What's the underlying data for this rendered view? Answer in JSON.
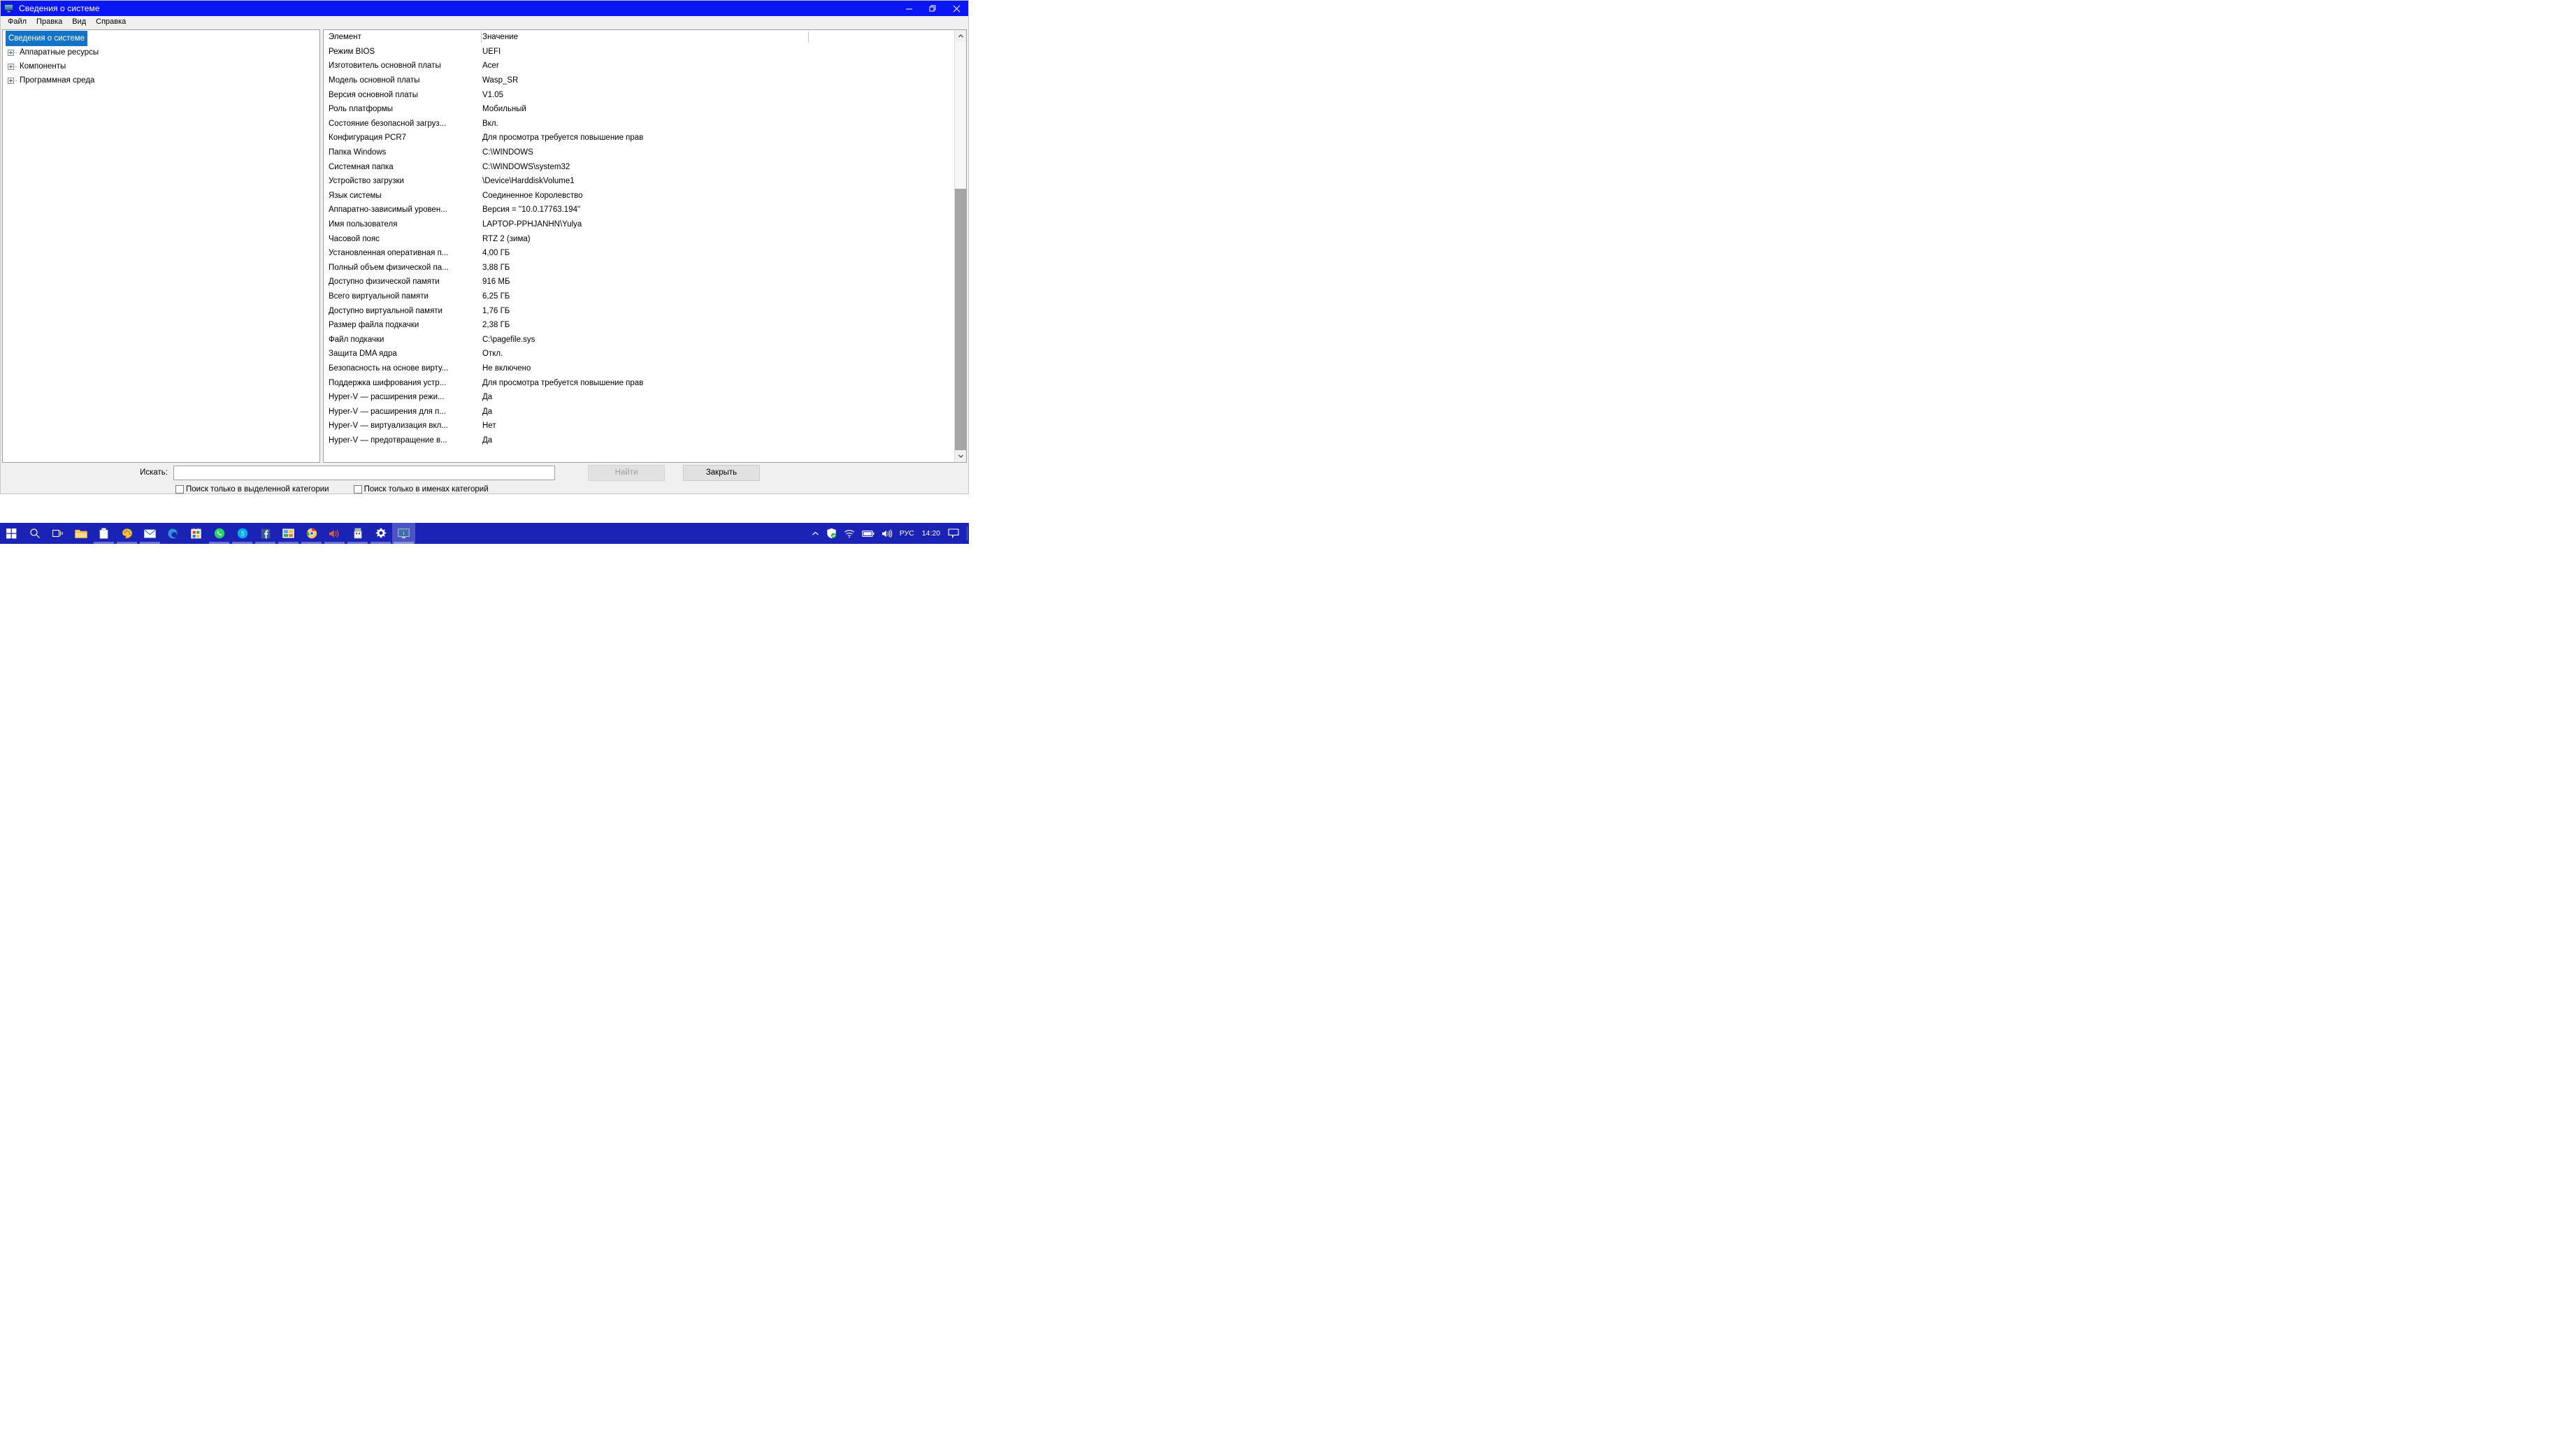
{
  "window": {
    "title": "Сведения о системе",
    "icon": "system-information-icon",
    "controls": {
      "minimize": "minimize-icon",
      "restore": "restore-icon",
      "close": "close-icon"
    }
  },
  "menubar": {
    "items": [
      {
        "label": "Файл"
      },
      {
        "label": "Правка"
      },
      {
        "label": "Вид"
      },
      {
        "label": "Справка"
      }
    ]
  },
  "tree": {
    "root": {
      "label": "Сведения о системе",
      "selected": true
    },
    "items": [
      {
        "label": "Аппаратные ресурсы",
        "expander": "plus-icon"
      },
      {
        "label": "Компоненты",
        "expander": "plus-icon"
      },
      {
        "label": "Программная среда",
        "expander": "plus-icon"
      }
    ]
  },
  "detail": {
    "columns": [
      "Элемент",
      "Значение"
    ],
    "rows": [
      [
        "Режим BIOS",
        "UEFI"
      ],
      [
        "Изготовитель основной платы",
        "Acer"
      ],
      [
        "Модель основной платы",
        "Wasp_SR"
      ],
      [
        "Версия основной платы",
        "V1.05"
      ],
      [
        "Роль платформы",
        "Мобильный"
      ],
      [
        "Состояние безопасной загруз...",
        "Вкл."
      ],
      [
        "Конфигурация PCR7",
        "Для просмотра требуется повышение прав"
      ],
      [
        "Папка Windows",
        "C:\\WINDOWS"
      ],
      [
        "Системная папка",
        "C:\\WINDOWS\\system32"
      ],
      [
        "Устройство загрузки",
        "\\Device\\HarddiskVolume1"
      ],
      [
        "Язык системы",
        "Соединенное Королевство"
      ],
      [
        "Аппаратно-зависимый уровен...",
        "Версия = \"10.0.17763.194\""
      ],
      [
        "Имя пользователя",
        "LAPTOP-PPHJANHN\\Yulya"
      ],
      [
        "Часовой пояс",
        "RTZ 2 (зима)"
      ],
      [
        "Установленная оперативная п...",
        "4,00 ГБ"
      ],
      [
        "Полный объем физической па...",
        "3,88 ГБ"
      ],
      [
        "Доступно физической памяти",
        "916 МБ"
      ],
      [
        "Всего виртуальной памяти",
        "6,25 ГБ"
      ],
      [
        "Доступно виртуальной памяти",
        "1,76 ГБ"
      ],
      [
        "Размер файла подкачки",
        "2,38 ГБ"
      ],
      [
        "Файл подкачки",
        "C:\\pagefile.sys"
      ],
      [
        "Защита DMA ядра",
        "Откл."
      ],
      [
        "Безопасность на основе вирту...",
        "Не включено"
      ],
      [
        "Поддержка шифрования устр...",
        "Для просмотра требуется повышение прав"
      ],
      [
        "Hyper-V — расширения режи...",
        "Да"
      ],
      [
        "Hyper-V — расширения для п...",
        "Да"
      ],
      [
        "Hyper-V — виртуализация вкл...",
        "Нет"
      ],
      [
        "Hyper-V — предотвращение в...",
        "Да"
      ]
    ]
  },
  "search": {
    "label": "Искать:",
    "value": "",
    "placeholder": "",
    "find_button": "Найти",
    "find_button_disabled": true,
    "close_button": "Закрыть",
    "checkbox_selected_category": "Поиск только в выделенной категории",
    "checkbox_category_names": "Поиск только в именах категорий",
    "checkbox_selected_category_checked": false,
    "checkbox_category_names_checked": false
  },
  "taskbar": {
    "buttons": [
      {
        "name": "start-icon"
      },
      {
        "name": "search-icon"
      },
      {
        "name": "task-view-icon"
      },
      {
        "name": "file-explorer-icon"
      },
      {
        "name": "sticky-notes-icon"
      },
      {
        "name": "paint-3d-icon"
      },
      {
        "name": "mail-icon"
      },
      {
        "name": "microsoft-edge-icon"
      },
      {
        "name": "microsoft-store-icon"
      },
      {
        "name": "whatsapp-icon"
      },
      {
        "name": "skype-icon"
      },
      {
        "name": "facebook-icon"
      },
      {
        "name": "photos-icon"
      },
      {
        "name": "google-chrome-icon"
      },
      {
        "name": "volume-app-icon"
      },
      {
        "name": "usb-device-icon"
      },
      {
        "name": "settings-gear-icon"
      },
      {
        "name": "system-information-icon"
      }
    ],
    "tray": {
      "overflow": "chevron-up-icon",
      "security": "windows-security-shield-icon",
      "network": "wifi-icon",
      "battery": "battery-icon",
      "volume": "speaker-icon",
      "language": "РУС",
      "clock": "14:20",
      "action_center": "notification-icon"
    }
  },
  "colors": {
    "title_bar": "#0b16f5",
    "taskbar": "#1a23b5",
    "selection": "#1273c7",
    "desktop": "#ffffff"
  }
}
